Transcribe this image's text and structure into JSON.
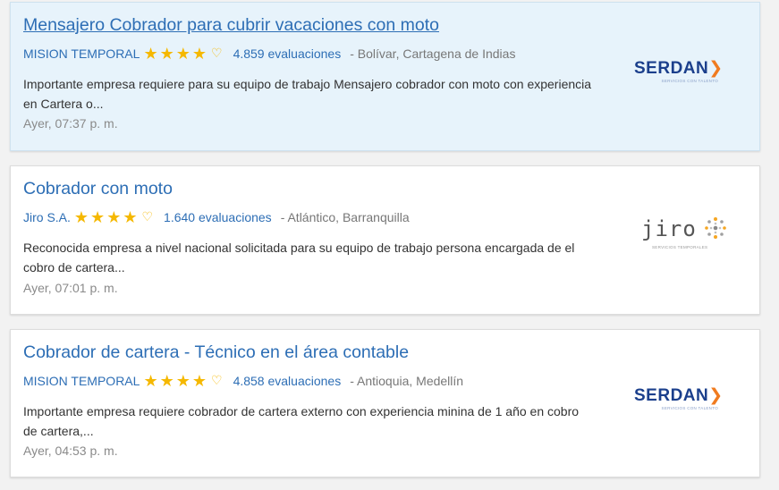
{
  "jobs": [
    {
      "title": "Mensajero Cobrador para cubrir vacaciones con moto",
      "company": "MISION TEMPORAL",
      "rating": 4,
      "reviews": "4.859 evaluaciones",
      "location": "- Bolívar, Cartagena de Indias",
      "description": "Importante empresa requiere para su equipo de trabajo Mensajero cobrador con moto con experiencia en Cartera o...",
      "date": "Ayer, 07:37 p. m.",
      "logo": {
        "brand": "SERDAN",
        "tagline": "SERVICIOS CON TALENTO"
      },
      "highlighted": true
    },
    {
      "title": "Cobrador con moto",
      "company": "Jiro S.A.",
      "rating": 4,
      "reviews": "1.640 evaluaciones",
      "location": "- Atlántico, Barranquilla",
      "description": "Reconocida empresa a nivel nacional solicitada para su equipo de trabajo persona encargada de el cobro de cartera...",
      "date": "Ayer, 07:01 p. m.",
      "logo": {
        "brand": "jiro",
        "tagline": "SERVICIOS TEMPORALES"
      },
      "highlighted": false
    },
    {
      "title": "Cobrador de cartera - Técnico en el área contable",
      "company": "MISION TEMPORAL",
      "rating": 4,
      "reviews": "4.858 evaluaciones",
      "location": "- Antioquia, Medellín",
      "description": "Importante empresa requiere cobrador de cartera externo con experiencia minina de 1 año en cobro de cartera,...",
      "date": "Ayer, 04:53 p. m.",
      "logo": {
        "brand": "SERDAN",
        "tagline": "SERVICIOS CON TALENTO"
      },
      "highlighted": false
    }
  ],
  "colors": {
    "link": "#2d6eb5",
    "star": "#f5b800",
    "highlight_bg": "#e7f3fb",
    "serdan_blue": "#1b3f8c",
    "serdan_orange": "#f07b1f"
  },
  "icons": {
    "star": "star-icon",
    "favorite": "heart-outline-icon"
  }
}
